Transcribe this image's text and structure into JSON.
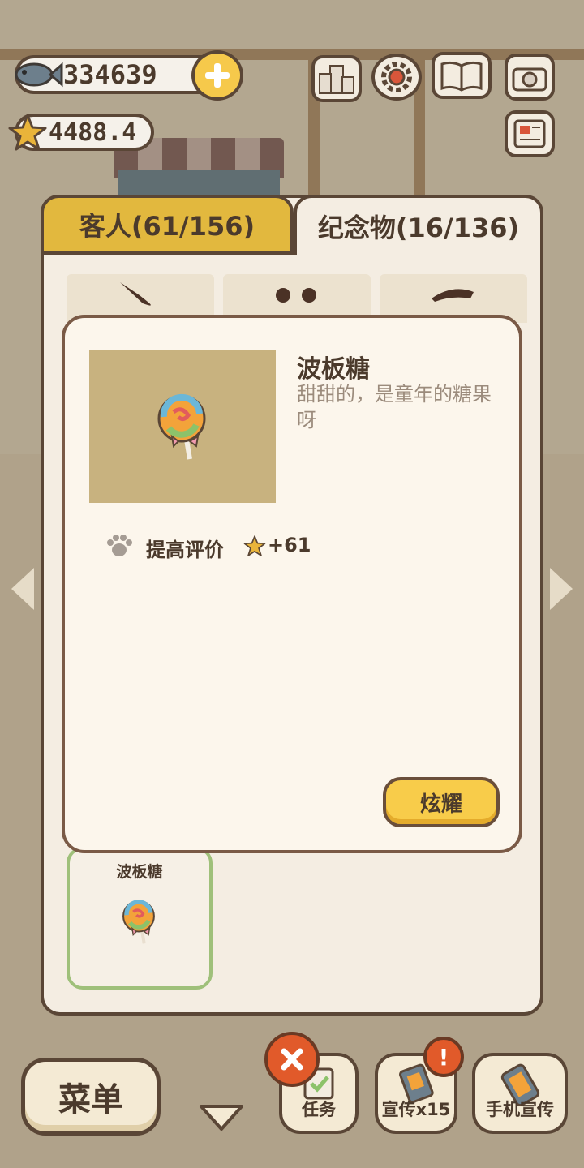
{
  "currency": {
    "fish": "334639",
    "stars": "4488.4"
  },
  "tabs": {
    "guests": "客人(61/156)",
    "souvenirs": "纪念物(16/136)"
  },
  "detail": {
    "name": "波板糖",
    "description": "甜甜的，是童年的糖果呀",
    "effect_label": "提高评价",
    "effect_value": "+61",
    "show_button": "炫耀"
  },
  "collected_item": {
    "label": "波板糖"
  },
  "bottom_bar": {
    "menu": "菜单",
    "tasks": "任务",
    "promote": "宣传x15",
    "phone_promote": "手机宣传",
    "alert": "!"
  },
  "icons": [
    "fish-icon",
    "star-icon",
    "plus-icon",
    "ranking-icon",
    "settings-icon",
    "book-icon",
    "camera-icon",
    "newspaper-icon",
    "paw-icon",
    "lollipop-icon",
    "close-icon",
    "chevron-down-icon"
  ],
  "colors": {
    "accent_yellow": "#f8cc4a",
    "outline": "#5a4636",
    "close_red": "#e15a2a",
    "collected_border": "#9fc07a"
  }
}
